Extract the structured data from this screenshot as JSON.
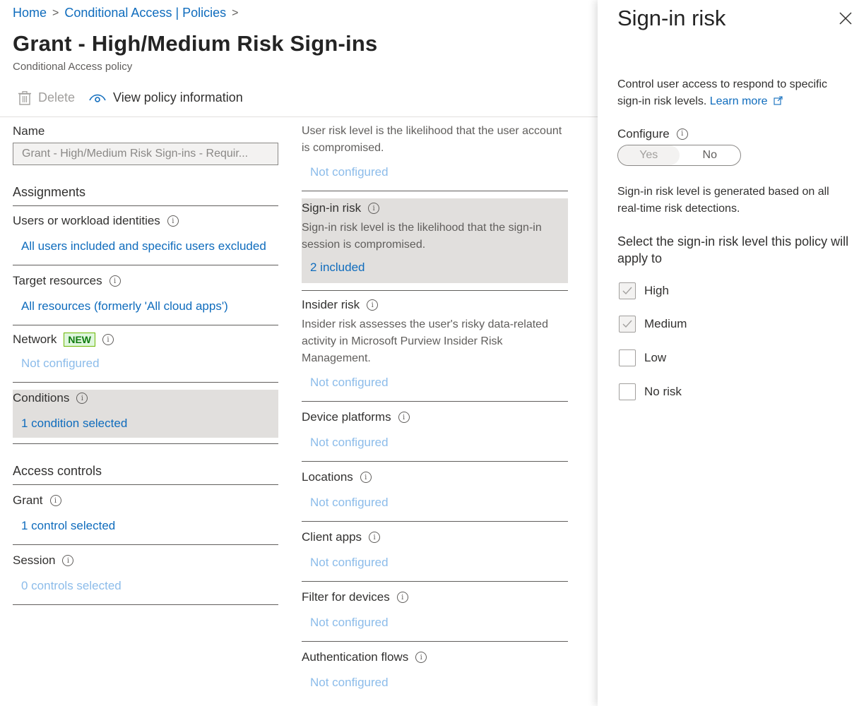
{
  "breadcrumb": {
    "home": "Home",
    "policies": "Conditional Access | Policies",
    "sep": ">"
  },
  "header": {
    "title": "Grant - High/Medium Risk Sign-ins",
    "subtitle": "Conditional Access policy"
  },
  "toolbar": {
    "delete_label": "Delete",
    "view_label": "View policy information"
  },
  "left": {
    "name_label": "Name",
    "name_value": "Grant - High/Medium Risk Sign-ins - Requir...",
    "assignments": "Assignments",
    "users_label": "Users or workload identities",
    "users_value": "All users included and specific users excluded",
    "target_label": "Target resources",
    "target_value": "All resources (formerly 'All cloud apps')",
    "network_label": "Network",
    "network_badge": "NEW",
    "network_value": "Not configured",
    "conditions_label": "Conditions",
    "conditions_value": "1 condition selected",
    "access_controls": "Access controls",
    "grant_label": "Grant",
    "grant_value": "1 control selected",
    "session_label": "Session",
    "session_value": "0 controls selected"
  },
  "middle": {
    "user_risk_desc": "User risk level is the likelihood that the user account is compromised.",
    "user_risk_value": "Not configured",
    "signin_label": "Sign-in risk",
    "signin_desc": "Sign-in risk level is the likelihood that the sign-in session is compromised.",
    "signin_value": "2 included",
    "insider_label": "Insider risk",
    "insider_desc": "Insider risk assesses the user's risky data-related activity in Microsoft Purview Insider Risk Management.",
    "insider_value": "Not configured",
    "device_label": "Device platforms",
    "device_value": "Not configured",
    "locations_label": "Locations",
    "locations_value": "Not configured",
    "client_label": "Client apps",
    "client_value": "Not configured",
    "filter_label": "Filter for devices",
    "filter_value": "Not configured",
    "auth_label": "Authentication flows",
    "auth_value": "Not configured"
  },
  "panel": {
    "title": "Sign-in risk",
    "intro": "Control user access to respond to specific sign-in risk levels.",
    "learn_more": "Learn more",
    "configure_label": "Configure",
    "toggle_yes": "Yes",
    "toggle_no": "No",
    "note": "Sign-in risk level is generated based on all real-time risk detections.",
    "select_prompt": "Select the sign-in risk level this policy will apply to",
    "levels": [
      {
        "label": "High",
        "checked": true
      },
      {
        "label": "Medium",
        "checked": true
      },
      {
        "label": "Low",
        "checked": false
      },
      {
        "label": "No risk",
        "checked": false
      }
    ]
  }
}
